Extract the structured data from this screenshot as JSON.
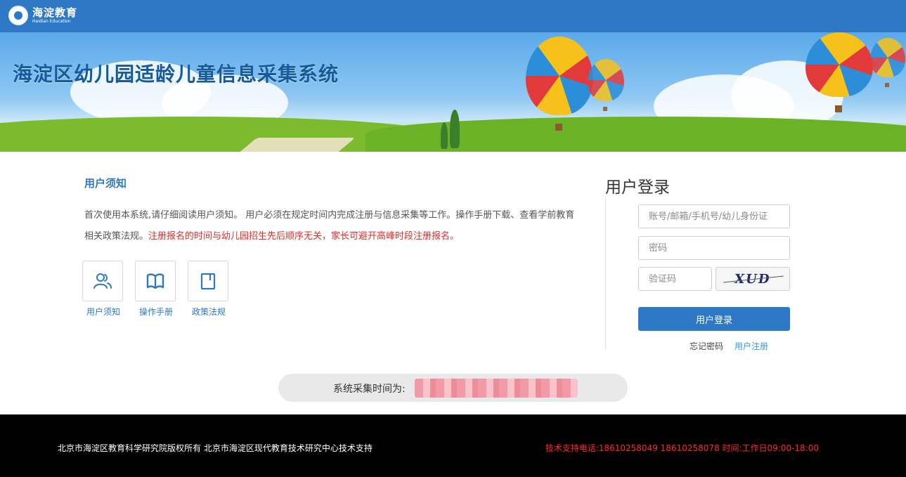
{
  "header": {
    "logo_cn": "海淀教育",
    "logo_en": "Haidian Education"
  },
  "banner": {
    "title": "海淀区幼儿园适龄儿童信息采集系统"
  },
  "notice": {
    "title": "用户须知",
    "text": "首次使用本系统,请仔细阅读用户须知。 用户必须在规定时间内完成注册与信息采集等工作。操作手册下载、查看学前教育相关政策法规。",
    "warning": "注册报名的时间与幼儿园招生先后顺序无关，家长可避开高峰时段注册报名。",
    "tiles": [
      {
        "label": "用户须知",
        "icon": "users-icon"
      },
      {
        "label": "操作手册",
        "icon": "book-icon"
      },
      {
        "label": "政策法规",
        "icon": "document-icon"
      }
    ]
  },
  "login": {
    "title": "用户登录",
    "account_placeholder": "账号/邮箱/手机号/幼儿身份证",
    "password_placeholder": "密码",
    "captcha_placeholder": "验证码",
    "captcha_text": "XUD",
    "submit_label": "用户登录",
    "forgot_label": "忘记密码",
    "register_label": "用户注册"
  },
  "collection": {
    "label": "系统采集时间为:"
  },
  "footer": {
    "copyright": "北京市海淀区教育科学研究院版权所有 北京市海淀区现代教育技术研究中心技术支持",
    "support": "技术支持电话:18610258049 18610258078 时间:工作日09:00-18:00"
  },
  "colors": {
    "primary": "#2e78c5",
    "warning": "#e32b2b",
    "footer_bg": "#000000"
  }
}
